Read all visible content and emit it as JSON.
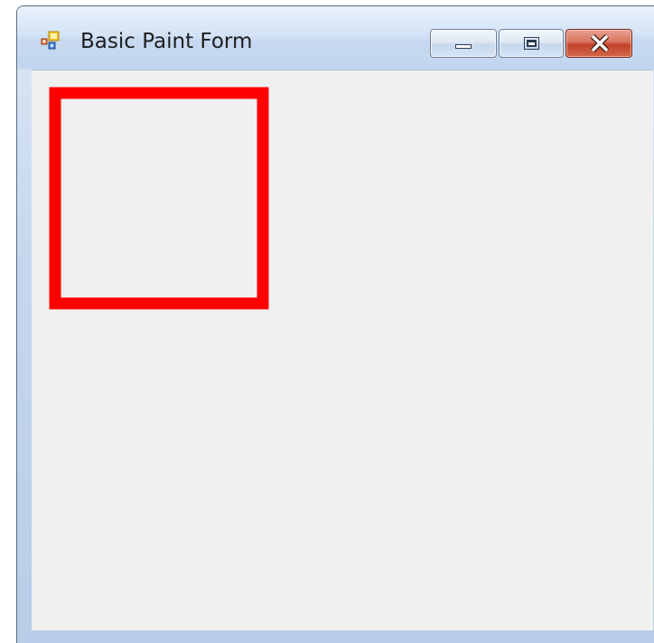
{
  "window": {
    "title": "Basic Paint Form"
  },
  "icons": {
    "app": "form-app-icon",
    "minimize": "minimize-icon",
    "maximize": "maximize-icon",
    "close": "close-icon"
  },
  "canvas": {
    "background": "#f0f0f0",
    "shapes": [
      {
        "type": "rectangle",
        "stroke": "#ff0000"
      }
    ]
  },
  "colors": {
    "close_button": "#c94a33",
    "rectangle_stroke": "#ff0000"
  }
}
